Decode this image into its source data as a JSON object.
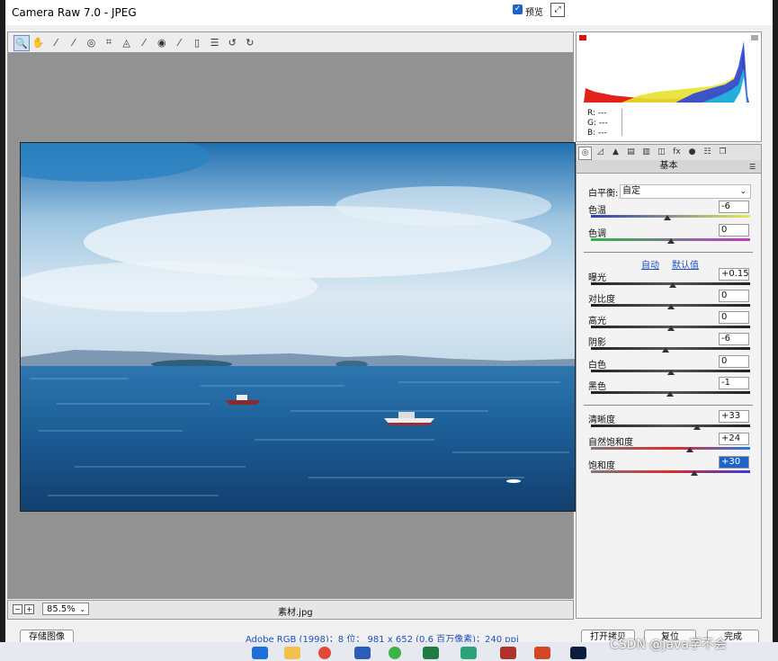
{
  "window": {
    "title": "Camera Raw 7.0 -  JPEG"
  },
  "toolbar": {
    "tools": [
      {
        "name": "zoom-tool",
        "glyph": "🔍"
      },
      {
        "name": "hand-tool",
        "glyph": "✋"
      },
      {
        "name": "white-balance-tool",
        "glyph": "⁄"
      },
      {
        "name": "color-sampler-tool",
        "glyph": "⁄"
      },
      {
        "name": "targeted-adjustment-tool",
        "glyph": "◎"
      },
      {
        "name": "crop-tool",
        "glyph": "⌗"
      },
      {
        "name": "straighten-tool",
        "glyph": "◬"
      },
      {
        "name": "spot-removal-tool",
        "glyph": "⁄"
      },
      {
        "name": "red-eye-tool",
        "glyph": "◉"
      },
      {
        "name": "adjustment-brush-tool",
        "glyph": "⁄"
      },
      {
        "name": "graduated-filter-tool",
        "glyph": "▯"
      },
      {
        "name": "preferences-tool",
        "glyph": "☰"
      },
      {
        "name": "rotate-left-tool",
        "glyph": "↺"
      },
      {
        "name": "rotate-right-tool",
        "glyph": "↻"
      }
    ],
    "preview_label": "预览",
    "preview_checked": "✓"
  },
  "status": {
    "zoom": "85.5%",
    "filename": "素材.jpg",
    "zoom_out": "−",
    "zoom_in": "+"
  },
  "histogram": {
    "r": "R:  ---",
    "g": "G:  ---",
    "b": "B:  ---"
  },
  "panel": {
    "section_title": "基本",
    "white_balance": {
      "label": "白平衡:",
      "value": "自定"
    },
    "auto_link": "自动",
    "default_link": "默认值",
    "sliders": [
      {
        "id": "temp",
        "label": "色温",
        "value": "-6",
        "position": 0.48
      },
      {
        "id": "tint",
        "label": "色调",
        "value": "0",
        "position": 0.5
      },
      {
        "id": "exposure",
        "label": "曝光",
        "value": "+0.15",
        "position": 0.515
      },
      {
        "id": "contrast",
        "label": "对比度",
        "value": "0",
        "position": 0.5
      },
      {
        "id": "highlights",
        "label": "高光",
        "value": "0",
        "position": 0.5
      },
      {
        "id": "shadows",
        "label": "阴影",
        "value": "-6",
        "position": 0.47
      },
      {
        "id": "whites",
        "label": "白色",
        "value": "0",
        "position": 0.5
      },
      {
        "id": "blacks",
        "label": "黑色",
        "value": "-1",
        "position": 0.495
      },
      {
        "id": "clarity",
        "label": "清晰度",
        "value": "+33",
        "position": 0.665
      },
      {
        "id": "vibrance",
        "label": "自然饱和度",
        "value": "+24",
        "position": 0.62
      },
      {
        "id": "saturation",
        "label": "饱和度",
        "value": "+30",
        "position": 0.65
      }
    ]
  },
  "bottom": {
    "save_image": "存储图像",
    "info": "Adobe RGB (1998)；8 位；  981 x 652 (0.6 百万像素)；240 ppi",
    "open_copy": "打开拷贝",
    "reset": "复位",
    "done": "完成"
  },
  "watermark": "CSDN @Java学不会"
}
